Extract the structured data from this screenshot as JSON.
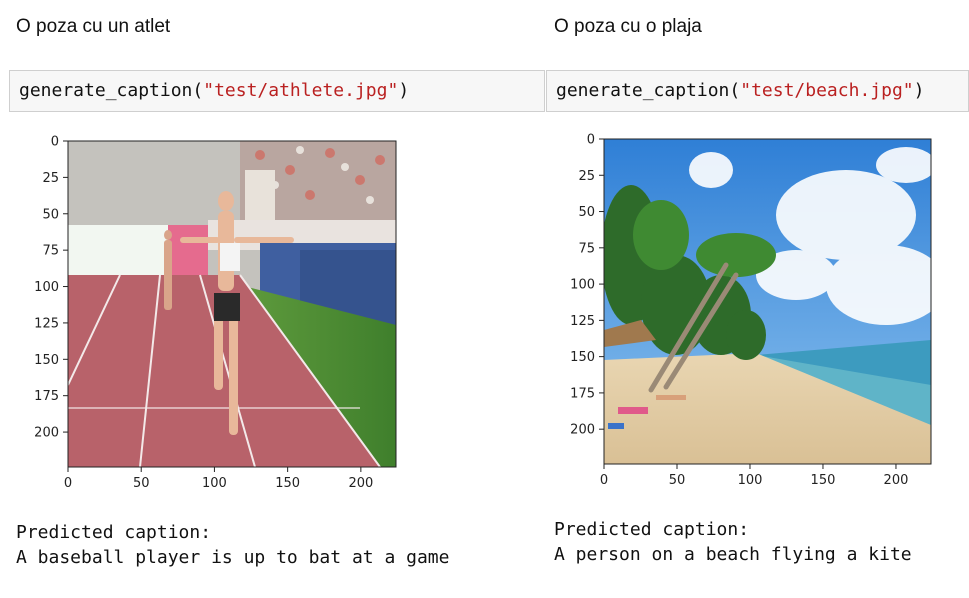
{
  "panels": [
    {
      "title": "O poza cu un atlet",
      "code": {
        "fn": "generate_caption",
        "arg": "\"test/athlete.jpg\""
      },
      "plot": {
        "xticks": [
          "0",
          "50",
          "100",
          "150",
          "200"
        ],
        "yticks": [
          "0",
          "25",
          "50",
          "75",
          "100",
          "125",
          "150",
          "175",
          "200"
        ],
        "image_alt": "athlete photo"
      },
      "output": {
        "label": "Predicted caption:",
        "caption": "A baseball player is up to bat at a game"
      }
    },
    {
      "title": "O poza cu o plaja",
      "code": {
        "fn": "generate_caption",
        "arg": "\"test/beach.jpg\""
      },
      "plot": {
        "xticks": [
          "0",
          "50",
          "100",
          "150",
          "200"
        ],
        "yticks": [
          "0",
          "25",
          "50",
          "75",
          "100",
          "125",
          "150",
          "175",
          "200"
        ],
        "image_alt": "beach photo"
      },
      "output": {
        "label": "Predicted caption:",
        "caption": "A person on a beach flying a kite"
      }
    }
  ]
}
